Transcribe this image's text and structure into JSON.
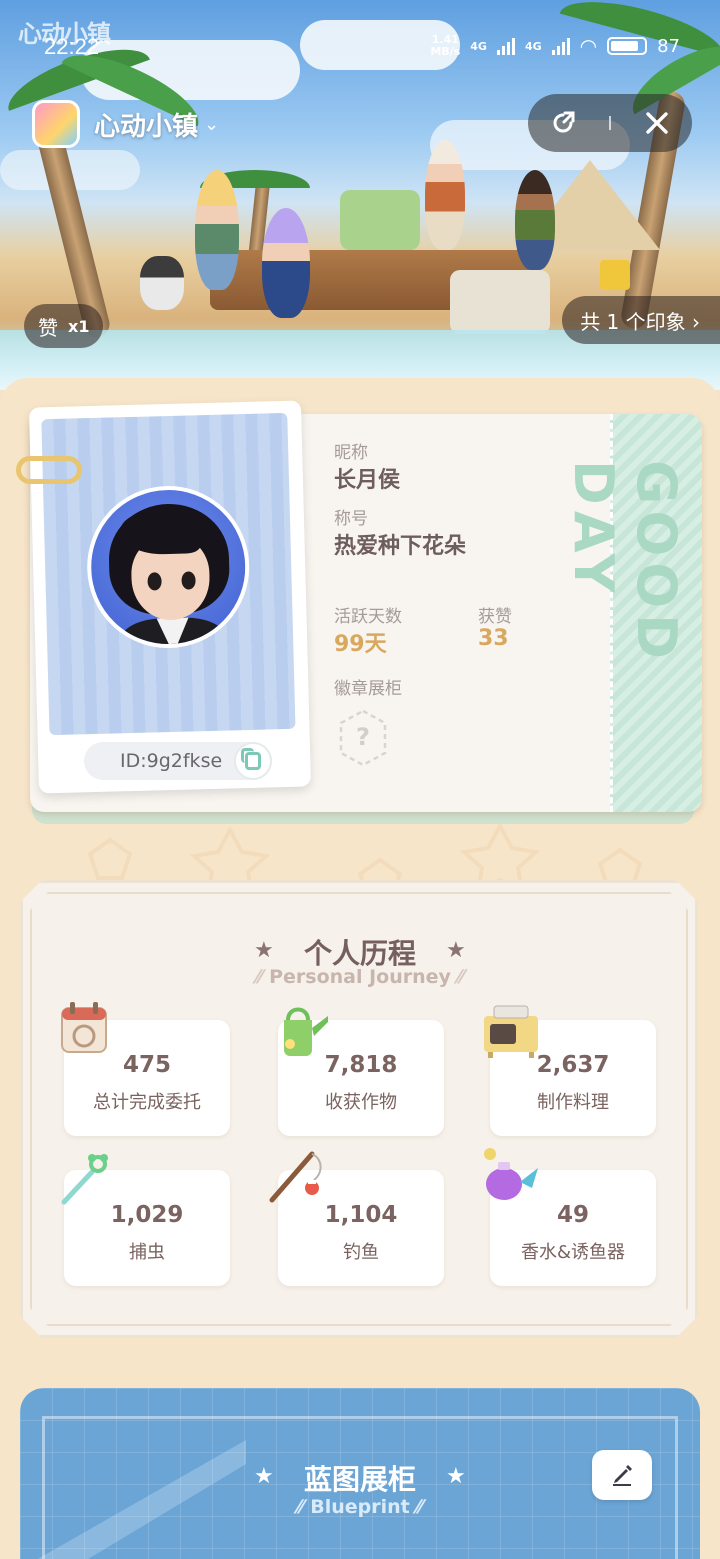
{
  "status_bar": {
    "time": "22:22",
    "speed_value": "1.41",
    "speed_unit": "MB/s",
    "network_1": "4G",
    "network_2": "4G",
    "battery": "87"
  },
  "header": {
    "app_name": "心动小镇"
  },
  "hero": {
    "likes_label": "赞",
    "likes_count": "x1",
    "impressions_label": "共 1 个印象 ›"
  },
  "profile": {
    "nickname_label": "昵称",
    "nickname": "长月侯",
    "title_label": "称号",
    "title": "热爱种下花朵",
    "active_days_label": "活跃天数",
    "active_days": "99天",
    "likes_label": "获赞",
    "likes": "33",
    "badge_label": "徽章展柜",
    "id": "ID:9g2fkse",
    "stub_text": "GOOD DAY"
  },
  "journey": {
    "title": "个人历程",
    "subtitle": "Personal Journey",
    "stats": [
      {
        "value": "475",
        "label": "总计完成委托",
        "icon": "calendar-icon"
      },
      {
        "value": "7,818",
        "label": "收获作物",
        "icon": "watering-can-icon"
      },
      {
        "value": "2,637",
        "label": "制作料理",
        "icon": "stove-icon"
      },
      {
        "value": "1,029",
        "label": "捕虫",
        "icon": "bug-net-icon"
      },
      {
        "value": "1,104",
        "label": "钓鱼",
        "icon": "fishing-rod-icon"
      },
      {
        "value": "49",
        "label": "香水&诱鱼器",
        "icon": "perfume-icon"
      }
    ]
  },
  "blueprint": {
    "title": "蓝图展柜",
    "subtitle": "Blueprint"
  },
  "colors": {
    "accent_gold": "#d8a85e",
    "sheet_bg": "#f7e5c9",
    "blueprint_blue": "#6ba5d6"
  }
}
